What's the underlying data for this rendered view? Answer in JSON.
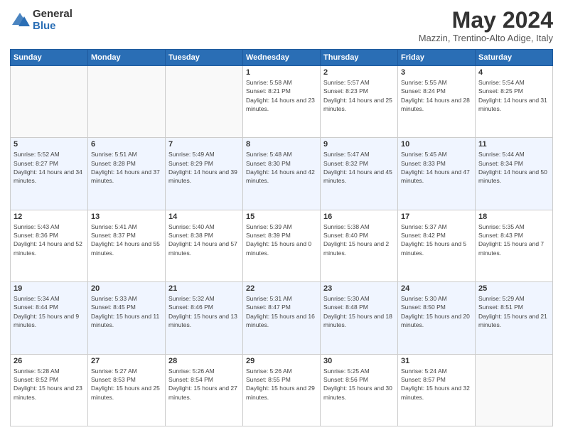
{
  "header": {
    "logo_general": "General",
    "logo_blue": "Blue",
    "month_title": "May 2024",
    "location": "Mazzin, Trentino-Alto Adige, Italy"
  },
  "days_of_week": [
    "Sunday",
    "Monday",
    "Tuesday",
    "Wednesday",
    "Thursday",
    "Friday",
    "Saturday"
  ],
  "weeks": [
    [
      {
        "day": "",
        "sunrise": "",
        "sunset": "",
        "daylight": ""
      },
      {
        "day": "",
        "sunrise": "",
        "sunset": "",
        "daylight": ""
      },
      {
        "day": "",
        "sunrise": "",
        "sunset": "",
        "daylight": ""
      },
      {
        "day": "1",
        "sunrise": "Sunrise: 5:58 AM",
        "sunset": "Sunset: 8:21 PM",
        "daylight": "Daylight: 14 hours and 23 minutes."
      },
      {
        "day": "2",
        "sunrise": "Sunrise: 5:57 AM",
        "sunset": "Sunset: 8:23 PM",
        "daylight": "Daylight: 14 hours and 25 minutes."
      },
      {
        "day": "3",
        "sunrise": "Sunrise: 5:55 AM",
        "sunset": "Sunset: 8:24 PM",
        "daylight": "Daylight: 14 hours and 28 minutes."
      },
      {
        "day": "4",
        "sunrise": "Sunrise: 5:54 AM",
        "sunset": "Sunset: 8:25 PM",
        "daylight": "Daylight: 14 hours and 31 minutes."
      }
    ],
    [
      {
        "day": "5",
        "sunrise": "Sunrise: 5:52 AM",
        "sunset": "Sunset: 8:27 PM",
        "daylight": "Daylight: 14 hours and 34 minutes."
      },
      {
        "day": "6",
        "sunrise": "Sunrise: 5:51 AM",
        "sunset": "Sunset: 8:28 PM",
        "daylight": "Daylight: 14 hours and 37 minutes."
      },
      {
        "day": "7",
        "sunrise": "Sunrise: 5:49 AM",
        "sunset": "Sunset: 8:29 PM",
        "daylight": "Daylight: 14 hours and 39 minutes."
      },
      {
        "day": "8",
        "sunrise": "Sunrise: 5:48 AM",
        "sunset": "Sunset: 8:30 PM",
        "daylight": "Daylight: 14 hours and 42 minutes."
      },
      {
        "day": "9",
        "sunrise": "Sunrise: 5:47 AM",
        "sunset": "Sunset: 8:32 PM",
        "daylight": "Daylight: 14 hours and 45 minutes."
      },
      {
        "day": "10",
        "sunrise": "Sunrise: 5:45 AM",
        "sunset": "Sunset: 8:33 PM",
        "daylight": "Daylight: 14 hours and 47 minutes."
      },
      {
        "day": "11",
        "sunrise": "Sunrise: 5:44 AM",
        "sunset": "Sunset: 8:34 PM",
        "daylight": "Daylight: 14 hours and 50 minutes."
      }
    ],
    [
      {
        "day": "12",
        "sunrise": "Sunrise: 5:43 AM",
        "sunset": "Sunset: 8:36 PM",
        "daylight": "Daylight: 14 hours and 52 minutes."
      },
      {
        "day": "13",
        "sunrise": "Sunrise: 5:41 AM",
        "sunset": "Sunset: 8:37 PM",
        "daylight": "Daylight: 14 hours and 55 minutes."
      },
      {
        "day": "14",
        "sunrise": "Sunrise: 5:40 AM",
        "sunset": "Sunset: 8:38 PM",
        "daylight": "Daylight: 14 hours and 57 minutes."
      },
      {
        "day": "15",
        "sunrise": "Sunrise: 5:39 AM",
        "sunset": "Sunset: 8:39 PM",
        "daylight": "Daylight: 15 hours and 0 minutes."
      },
      {
        "day": "16",
        "sunrise": "Sunrise: 5:38 AM",
        "sunset": "Sunset: 8:40 PM",
        "daylight": "Daylight: 15 hours and 2 minutes."
      },
      {
        "day": "17",
        "sunrise": "Sunrise: 5:37 AM",
        "sunset": "Sunset: 8:42 PM",
        "daylight": "Daylight: 15 hours and 5 minutes."
      },
      {
        "day": "18",
        "sunrise": "Sunrise: 5:35 AM",
        "sunset": "Sunset: 8:43 PM",
        "daylight": "Daylight: 15 hours and 7 minutes."
      }
    ],
    [
      {
        "day": "19",
        "sunrise": "Sunrise: 5:34 AM",
        "sunset": "Sunset: 8:44 PM",
        "daylight": "Daylight: 15 hours and 9 minutes."
      },
      {
        "day": "20",
        "sunrise": "Sunrise: 5:33 AM",
        "sunset": "Sunset: 8:45 PM",
        "daylight": "Daylight: 15 hours and 11 minutes."
      },
      {
        "day": "21",
        "sunrise": "Sunrise: 5:32 AM",
        "sunset": "Sunset: 8:46 PM",
        "daylight": "Daylight: 15 hours and 13 minutes."
      },
      {
        "day": "22",
        "sunrise": "Sunrise: 5:31 AM",
        "sunset": "Sunset: 8:47 PM",
        "daylight": "Daylight: 15 hours and 16 minutes."
      },
      {
        "day": "23",
        "sunrise": "Sunrise: 5:30 AM",
        "sunset": "Sunset: 8:48 PM",
        "daylight": "Daylight: 15 hours and 18 minutes."
      },
      {
        "day": "24",
        "sunrise": "Sunrise: 5:30 AM",
        "sunset": "Sunset: 8:50 PM",
        "daylight": "Daylight: 15 hours and 20 minutes."
      },
      {
        "day": "25",
        "sunrise": "Sunrise: 5:29 AM",
        "sunset": "Sunset: 8:51 PM",
        "daylight": "Daylight: 15 hours and 21 minutes."
      }
    ],
    [
      {
        "day": "26",
        "sunrise": "Sunrise: 5:28 AM",
        "sunset": "Sunset: 8:52 PM",
        "daylight": "Daylight: 15 hours and 23 minutes."
      },
      {
        "day": "27",
        "sunrise": "Sunrise: 5:27 AM",
        "sunset": "Sunset: 8:53 PM",
        "daylight": "Daylight: 15 hours and 25 minutes."
      },
      {
        "day": "28",
        "sunrise": "Sunrise: 5:26 AM",
        "sunset": "Sunset: 8:54 PM",
        "daylight": "Daylight: 15 hours and 27 minutes."
      },
      {
        "day": "29",
        "sunrise": "Sunrise: 5:26 AM",
        "sunset": "Sunset: 8:55 PM",
        "daylight": "Daylight: 15 hours and 29 minutes."
      },
      {
        "day": "30",
        "sunrise": "Sunrise: 5:25 AM",
        "sunset": "Sunset: 8:56 PM",
        "daylight": "Daylight: 15 hours and 30 minutes."
      },
      {
        "day": "31",
        "sunrise": "Sunrise: 5:24 AM",
        "sunset": "Sunset: 8:57 PM",
        "daylight": "Daylight: 15 hours and 32 minutes."
      },
      {
        "day": "",
        "sunrise": "",
        "sunset": "",
        "daylight": ""
      }
    ]
  ]
}
